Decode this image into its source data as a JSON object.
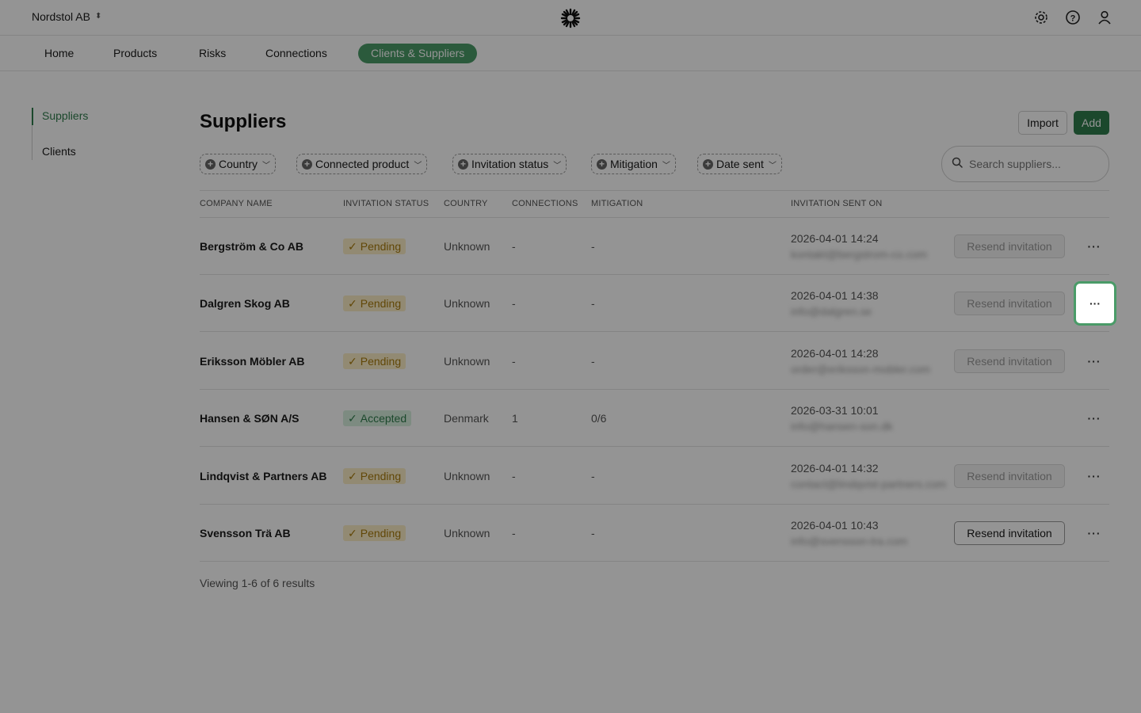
{
  "header": {
    "org_name": "Nordstol AB"
  },
  "nav": {
    "items": [
      "Home",
      "Products",
      "Risks",
      "Connections",
      "Clients & Suppliers"
    ],
    "active": "Clients & Suppliers"
  },
  "sidebar": {
    "items": [
      "Suppliers",
      "Clients"
    ],
    "active": "Suppliers"
  },
  "page": {
    "title": "Suppliers",
    "import_label": "Import",
    "add_label": "Add"
  },
  "filters": [
    "Country",
    "Connected product",
    "Invitation status",
    "Mitigation",
    "Date sent"
  ],
  "search": {
    "placeholder": "Search suppliers..."
  },
  "table": {
    "columns": [
      "COMPANY NAME",
      "INVITATION STATUS",
      "COUNTRY",
      "CONNECTIONS",
      "MITIGATION",
      "INVITATION SENT ON"
    ],
    "rows": [
      {
        "company": "Bergström & Co AB",
        "status": "Pending",
        "country": "Unknown",
        "connections": "-",
        "mitigation": "-",
        "sent": "2026-04-01 14:24",
        "email": "kontakt@bergstrom-co.com",
        "resend": "Resend invitation",
        "resend_enabled": false
      },
      {
        "company": "Dalgren Skog AB",
        "status": "Pending",
        "country": "Unknown",
        "connections": "-",
        "mitigation": "-",
        "sent": "2026-04-01 14:38",
        "email": "info@dalgren.se",
        "resend": "Resend invitation",
        "resend_enabled": false
      },
      {
        "company": "Eriksson Möbler AB",
        "status": "Pending",
        "country": "Unknown",
        "connections": "-",
        "mitigation": "-",
        "sent": "2026-04-01 14:28",
        "email": "order@eriksson-mobler.com",
        "resend": "Resend invitation",
        "resend_enabled": false
      },
      {
        "company": "Hansen & SØN A/S",
        "status": "Accepted",
        "country": "Denmark",
        "connections": "1",
        "mitigation": "0/6",
        "sent": "2026-03-31 10:01",
        "email": "info@hansen-son.dk",
        "resend": "",
        "resend_enabled": null
      },
      {
        "company": "Lindqvist & Partners AB",
        "status": "Pending",
        "country": "Unknown",
        "connections": "-",
        "mitigation": "-",
        "sent": "2026-04-01 14:32",
        "email": "contact@lindqvist-partners.com",
        "resend": "Resend invitation",
        "resend_enabled": false
      },
      {
        "company": "Svensson Trä AB",
        "status": "Pending",
        "country": "Unknown",
        "connections": "-",
        "mitigation": "-",
        "sent": "2026-04-01 10:43",
        "email": "info@svensson-tra.com",
        "resend": "Resend invitation",
        "resend_enabled": true
      }
    ]
  },
  "footer": {
    "summary": "Viewing 1-6 of 6 results"
  },
  "more_label": "···",
  "colors": {
    "accent": "#2f7d4d",
    "accent_light": "#4a9b68",
    "pending_bg": "#fbeec7",
    "pending_fg": "#a87a0c",
    "accepted_bg": "#d8efdf"
  }
}
